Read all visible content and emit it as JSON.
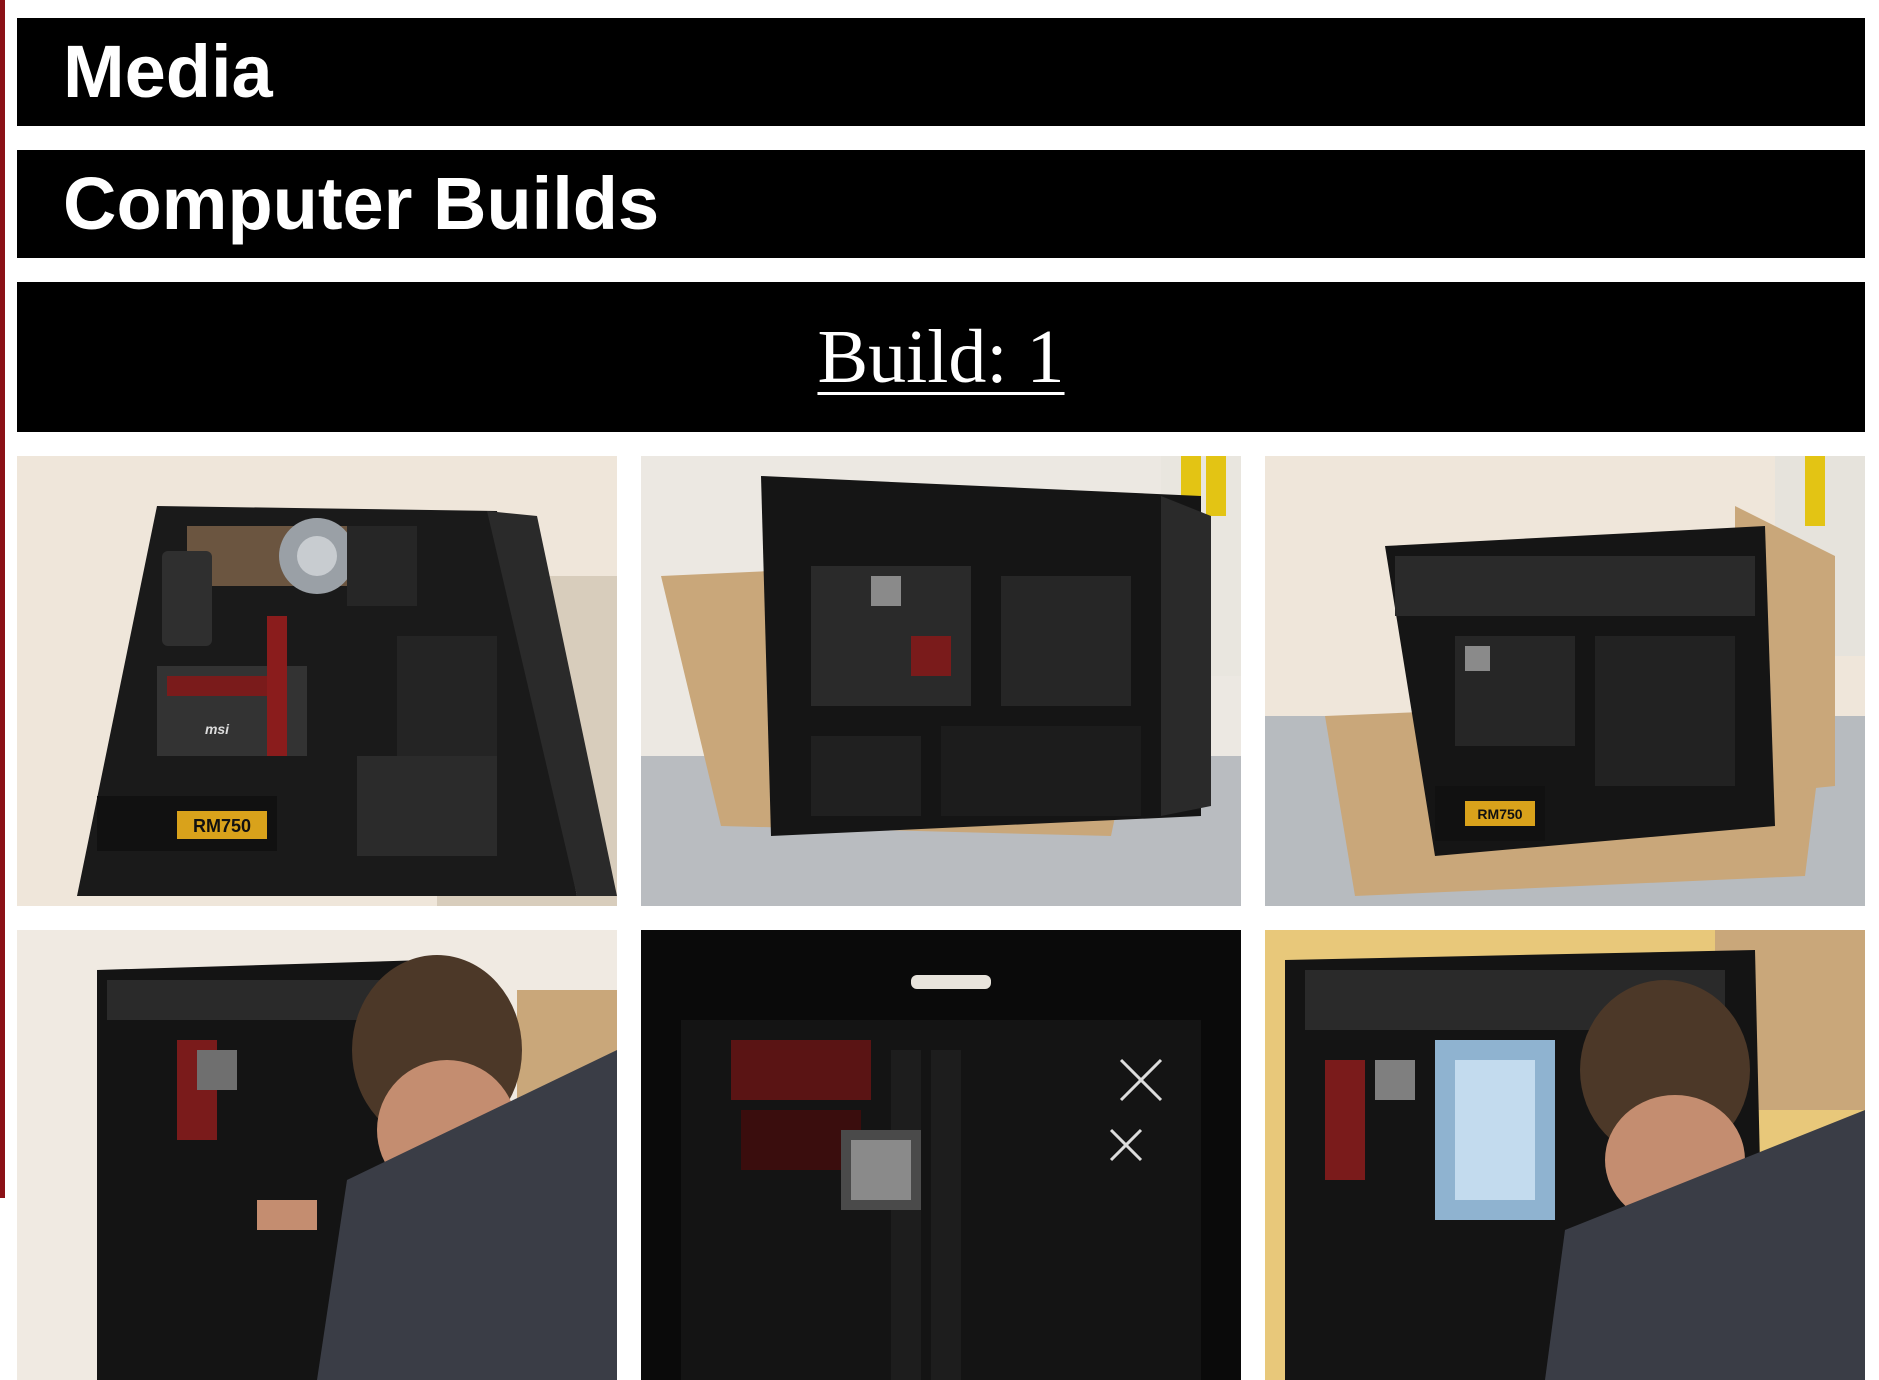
{
  "page": {
    "header_title": "Media",
    "section_title": "Computer Builds",
    "build_link_label": "Build: 1"
  },
  "gallery": {
    "photos": [
      {
        "description_icon": "pc-case-photo",
        "psu_label": "RM750",
        "brand": "msi"
      },
      {
        "description_icon": "pc-case-photo"
      },
      {
        "description_icon": "pc-case-photo",
        "psu_label": "RM750"
      },
      {
        "description_icon": "pc-case-with-person-photo"
      },
      {
        "description_icon": "pc-motherboard-closeup-photo"
      },
      {
        "description_icon": "pc-case-with-person-photo"
      }
    ]
  },
  "colors": {
    "accent_rule": "#8b1116",
    "bar_background": "#000000",
    "bar_text": "#ffffff"
  }
}
